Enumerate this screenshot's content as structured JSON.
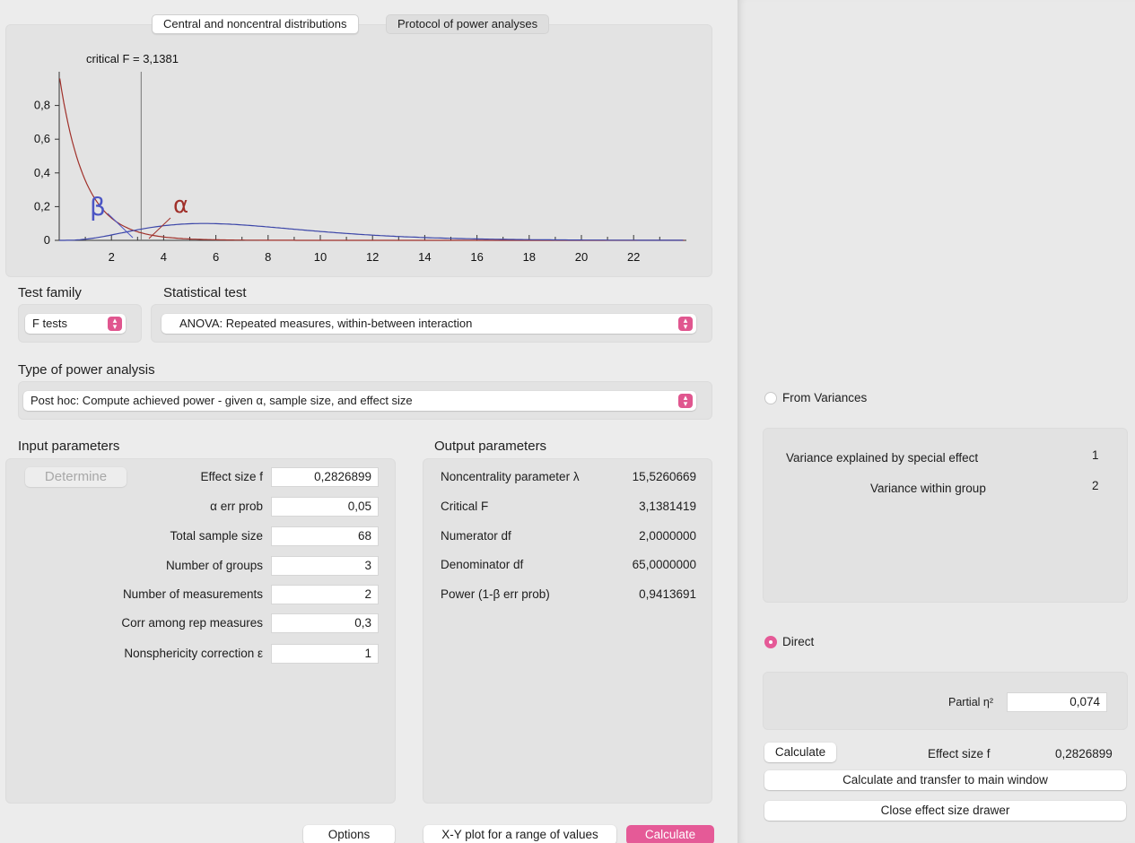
{
  "tabs": {
    "distributions": "Central and noncentral distributions",
    "protocol": "Protocol of power analyses"
  },
  "plot": {
    "critical_label": "critical F = 3,1381",
    "beta_symbol": "β",
    "alpha_symbol": "α",
    "y_ticks": [
      "0",
      "0,2",
      "0,4",
      "0,6",
      "0,8"
    ],
    "x_ticks": [
      "2",
      "4",
      "6",
      "8",
      "10",
      "12",
      "14",
      "16",
      "18",
      "20",
      "22"
    ],
    "critical_value": 3.1381,
    "xlim": [
      0,
      24
    ],
    "ylim": [
      0,
      1
    ],
    "central_color": "#a0302a",
    "noncentral_color": "#3b45a8"
  },
  "test_family": {
    "label": "Test family",
    "value": "F tests"
  },
  "statistical_test": {
    "label": "Statistical test",
    "value": "ANOVA: Repeated measures, within-between interaction"
  },
  "power_analysis": {
    "label": "Type of power analysis",
    "value": "Post hoc: Compute achieved power - given α, sample size, and effect size"
  },
  "input": {
    "heading": "Input parameters",
    "determine": "Determine",
    "rows": [
      {
        "label": "Effect size f",
        "value": "0,2826899"
      },
      {
        "label": "α err prob",
        "value": "0,05"
      },
      {
        "label": "Total sample size",
        "value": "68"
      },
      {
        "label": "Number of groups",
        "value": "3"
      },
      {
        "label": "Number of measurements",
        "value": "2"
      },
      {
        "label": "Corr among rep measures",
        "value": "0,3"
      },
      {
        "label": "Nonsphericity correction ε",
        "value": "1"
      }
    ]
  },
  "output": {
    "heading": "Output parameters",
    "rows": [
      {
        "label": "Noncentrality parameter λ",
        "value": "15,5260669"
      },
      {
        "label": "Critical F",
        "value": "3,1381419"
      },
      {
        "label": "Numerator df",
        "value": "2,0000000"
      },
      {
        "label": "Denominator df",
        "value": "65,0000000"
      },
      {
        "label": "Power (1-β err prob)",
        "value": "0,9413691"
      }
    ]
  },
  "footer": {
    "options": "Options",
    "xy_plot": "X-Y plot for a range of values",
    "calculate": "Calculate"
  },
  "drawer": {
    "from_variances": "From Variances",
    "variance_effect_label": "Variance explained by special effect",
    "variance_effect_value": "1",
    "variance_within_label": "Variance within group",
    "variance_within_value": "2",
    "direct": "Direct",
    "partial_eta_label": "Partial η²",
    "partial_eta_value": "0,074",
    "calculate": "Calculate",
    "effect_size_label": "Effect size f",
    "effect_size_value": "0,2826899",
    "transfer": "Calculate and transfer to main window",
    "close": "Close effect size drawer"
  },
  "colors": {
    "accent": "#e55a97"
  }
}
